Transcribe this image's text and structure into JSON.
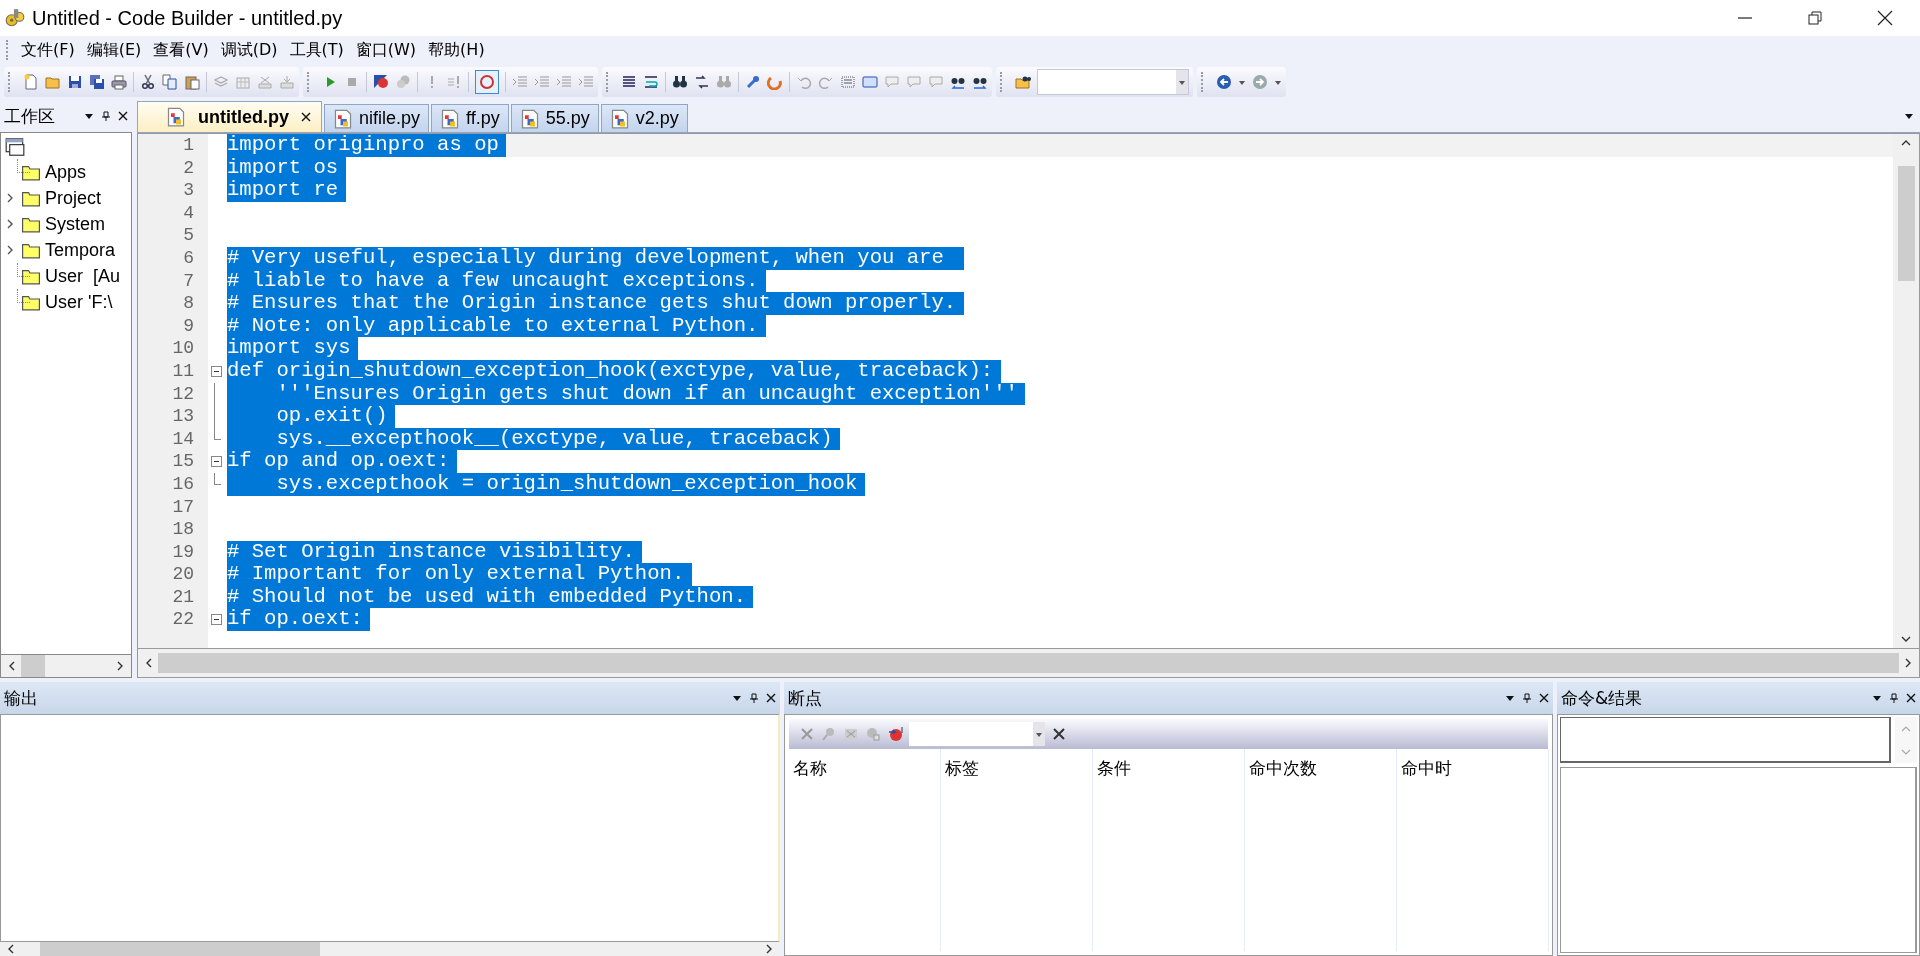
{
  "window": {
    "title": "Untitled - Code Builder - untitled.py"
  },
  "menu": [
    {
      "label": "文件(F)"
    },
    {
      "label": "编辑(E)"
    },
    {
      "label": "查看(V)"
    },
    {
      "label": "调试(D)"
    },
    {
      "label": "工具(T)"
    },
    {
      "label": "窗口(W)"
    },
    {
      "label": "帮助(H)"
    }
  ],
  "tabs": [
    {
      "label": "untitled.py",
      "selected": true
    },
    {
      "label": "nifile.py",
      "selected": false
    },
    {
      "label": "ff.py",
      "selected": false
    },
    {
      "label": "55.py",
      "selected": false
    },
    {
      "label": "v2.py",
      "selected": false
    }
  ],
  "workspace": {
    "title": "工作区",
    "items": [
      {
        "label": "Apps",
        "expandable": false
      },
      {
        "label": "Project",
        "expandable": true
      },
      {
        "label": "System",
        "expandable": true
      },
      {
        "label": "Tempora",
        "expandable": true
      },
      {
        "label": "User  [Au",
        "expandable": false
      },
      {
        "label": "User 'F:\\",
        "expandable": false
      }
    ]
  },
  "editor": {
    "lines": [
      {
        "number": "1",
        "text": "import originpro as op",
        "current": true,
        "kind": "plain"
      },
      {
        "number": "2",
        "text": "import os",
        "current": false,
        "kind": "plain"
      },
      {
        "number": "3",
        "text": "import re",
        "current": false,
        "kind": "plain"
      },
      {
        "number": "4",
        "current": false,
        "kind": "plain"
      },
      {
        "number": "5",
        "current": false,
        "kind": "plain"
      },
      {
        "number": "6",
        "text": "# Very useful, especially during development, when you are ",
        "current": false,
        "kind": "plain"
      },
      {
        "number": "7",
        "text": "# liable to have a few uncaught exceptions.",
        "current": false,
        "kind": "plain"
      },
      {
        "number": "8",
        "text": "# Ensures that the Origin instance gets shut down properly.",
        "current": false,
        "kind": "plain"
      },
      {
        "number": "9",
        "text": "# Note: only applicable to external Python.",
        "current": false,
        "kind": "plain"
      },
      {
        "number": "10",
        "text": "import sys",
        "current": false,
        "kind": "plain"
      },
      {
        "number": "11",
        "text": "def origin_shutdown_exception_hook(exctype, value, traceback):",
        "current": false,
        "kind": "foldstart"
      },
      {
        "number": "12",
        "text": "    '''Ensures Origin gets shut down if an uncaught exception'''",
        "current": false,
        "kind": "foldbody"
      },
      {
        "number": "13",
        "text": "    op.exit()",
        "current": false,
        "kind": "foldbody"
      },
      {
        "number": "14",
        "text": "    sys.__excepthook__(exctype, value, traceback)",
        "current": false,
        "kind": "foldend"
      },
      {
        "number": "15",
        "text": "if op and op.oext:",
        "current": false,
        "kind": "foldstart"
      },
      {
        "number": "16",
        "text": "    sys.excepthook = origin_shutdown_exception_hook",
        "current": false,
        "kind": "foldend"
      },
      {
        "number": "17",
        "current": false,
        "kind": "plain"
      },
      {
        "number": "18",
        "current": false,
        "kind": "plain"
      },
      {
        "number": "19",
        "text": "# Set Origin instance visibility.",
        "current": false,
        "kind": "plain"
      },
      {
        "number": "20",
        "text": "# Important for only external Python.",
        "current": false,
        "kind": "plain"
      },
      {
        "number": "21",
        "text": "# Should not be used with embedded Python.",
        "current": false,
        "kind": "plain"
      },
      {
        "number": "22",
        "text": "if op.oext:",
        "current": false,
        "kind": "foldstart"
      }
    ]
  },
  "output": {
    "title": "输出"
  },
  "breakpoints": {
    "title": "断点",
    "columns": [
      "名称",
      "标签",
      "条件",
      "命中次数",
      "命中时"
    ]
  },
  "command": {
    "title": "命令&结果"
  }
}
